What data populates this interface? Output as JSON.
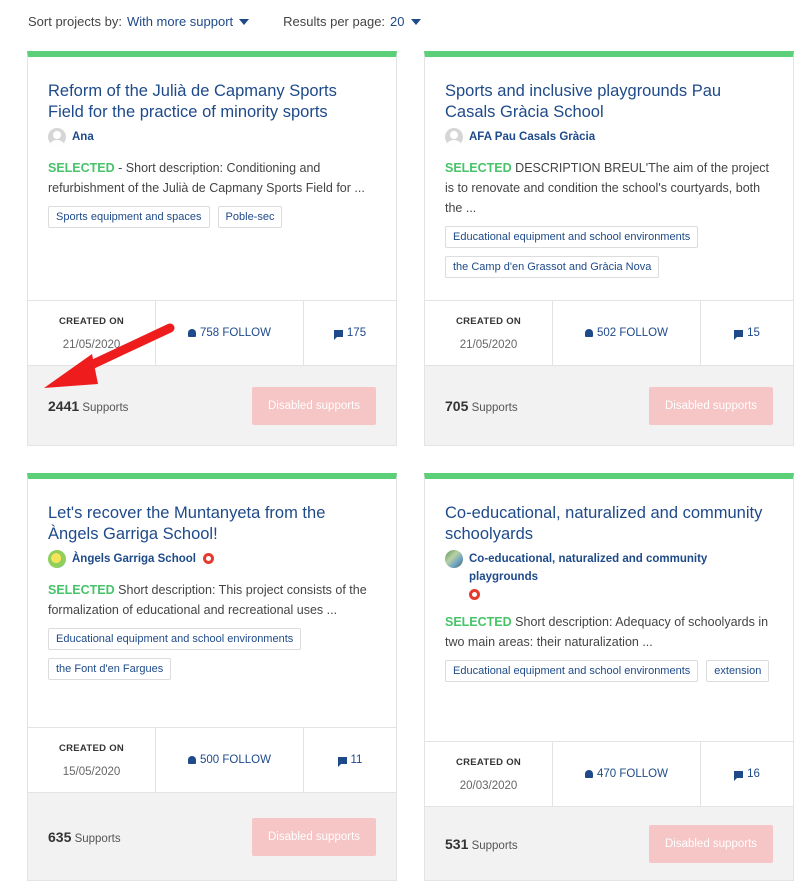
{
  "toolbar": {
    "sort_label": "Sort projects by:",
    "sort_value": "With more support",
    "results_label": "Results per page:",
    "results_value": "20"
  },
  "labels": {
    "created_on": "CREATED ON",
    "follow_suffix": "FOLLOW",
    "supports_suffix": "Supports",
    "disabled_supports": "Disabled supports",
    "selected": "SELECTED"
  },
  "projects": [
    {
      "title": "Reform of the Julià de Capmany Sports Field for the practice of minority sports",
      "author": "Ana",
      "description": " - Short description: Conditioning and refurbishment of the Julià de Capmany Sports Field for ...",
      "tags": [
        "Sports equipment and spaces",
        "Poble-sec"
      ],
      "created_on": "21/05/2020",
      "follow": "758 FOLLOW",
      "comments": "175",
      "supports": "2441"
    },
    {
      "title": "Sports and inclusive playgrounds Pau Casals Gràcia School",
      "author": "AFA Pau Casals Gràcia",
      "description": " DESCRIPTION BREUL'The aim of the project is to renovate and condition the school's courtyards, both the ...",
      "tags": [
        "Educational equipment and school environments",
        "the Camp d'en Grassot and Gràcia Nova"
      ],
      "created_on": "21/05/2020",
      "follow": "502 FOLLOW",
      "comments": "15",
      "supports": "705"
    },
    {
      "title": "Let's recover the Muntanyeta from the Àngels Garriga School!",
      "author": "Àngels Garriga School",
      "description": " Short description: This project consists of the formalization of educational and recreational uses ...",
      "tags": [
        "Educational equipment and school environments",
        "the Font d'en Fargues"
      ],
      "created_on": "15/05/2020",
      "follow": "500 FOLLOW",
      "comments": "11",
      "supports": "635"
    },
    {
      "title": "Co-educational, naturalized and community schoolyards",
      "author": "Co-educational, naturalized and community playgrounds",
      "description": " Short description: Adequacy of schoolyards in two main areas: their naturalization ...",
      "tags": [
        "Educational equipment and school environments",
        "extension"
      ],
      "created_on": "20/03/2020",
      "follow": "470 FOLLOW",
      "comments": "16",
      "supports": "531"
    }
  ]
}
